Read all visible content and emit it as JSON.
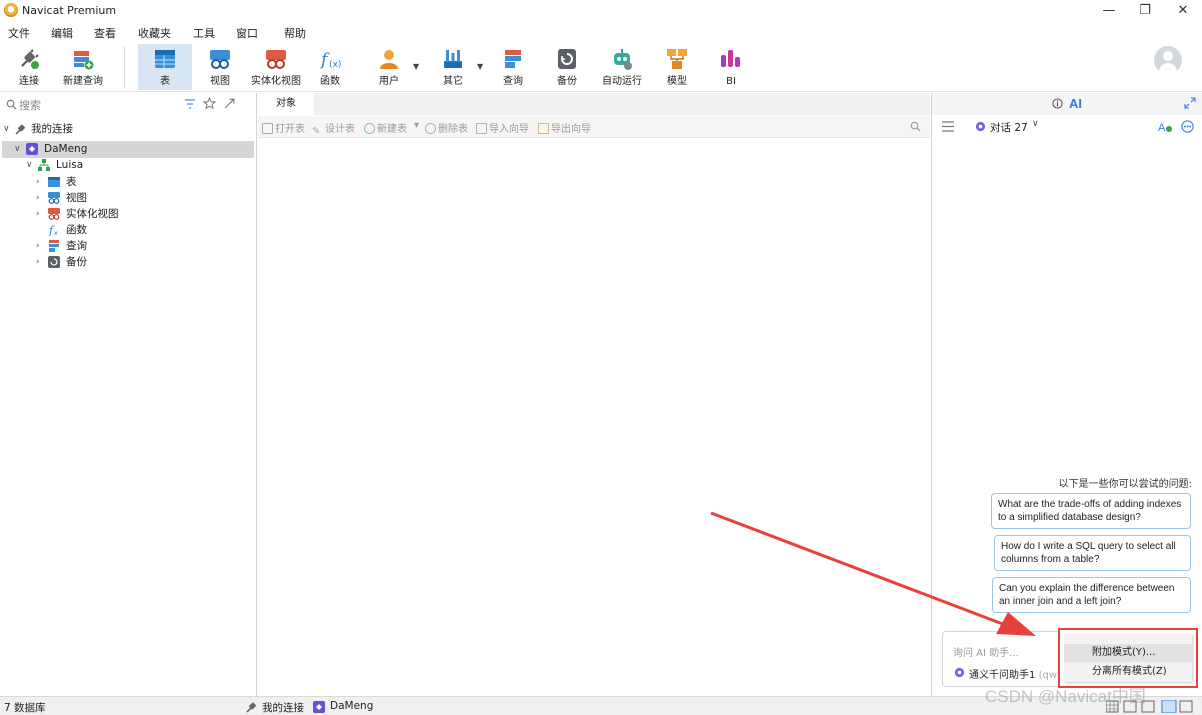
{
  "window": {
    "title": "Navicat Premium"
  },
  "menu": [
    "文件",
    "编辑",
    "查看",
    "收藏夹",
    "工具",
    "窗口",
    "帮助"
  ],
  "toolbar": {
    "connect": "连接",
    "new_query": "新建查询",
    "table": "表",
    "view": "视图",
    "matview": "实体化视图",
    "function": "函数",
    "user": "用户",
    "other": "其它",
    "query": "查询",
    "backup": "备份",
    "automation": "自动运行",
    "model": "模型",
    "bi": "BI"
  },
  "left": {
    "search_placeholder": "搜索",
    "tree": {
      "root": "我的连接",
      "connection": "DaMeng",
      "schema": "Luisa",
      "nodes": [
        "表",
        "视图",
        "实体化视图",
        "函数",
        "查询",
        "备份"
      ]
    }
  },
  "center": {
    "tab_label": "对象",
    "obj_toolbar": [
      "打开表",
      "设计表",
      "新建表",
      "删除表",
      "导入向导",
      "导出向导"
    ]
  },
  "ai": {
    "title": "AI",
    "conversation": "对话 27",
    "suggest_hint": "以下是一些你可以尝试的问题:",
    "suggestions": [
      "What are the trade-offs of adding indexes to a simplified database design?",
      "How do I write a SQL query to select all columns from a table?",
      "Can you explain the difference between an inner join and a left join?"
    ],
    "input_placeholder": "询问 AI 助手...",
    "model_name": "通义千问助手1",
    "model_sub": "(qwe"
  },
  "context_menu": {
    "items": [
      "附加模式(Y)...",
      "分离所有模式(Z)"
    ]
  },
  "status": {
    "db_count": "7 数据库",
    "conn_root": "我的连接",
    "conn_name": "DaMeng"
  },
  "watermark": "CSDN @Navicat中国",
  "colors": {
    "accent": "#2f7de1",
    "highlight_border": "#e8413c",
    "arrow": "#e8413c"
  }
}
